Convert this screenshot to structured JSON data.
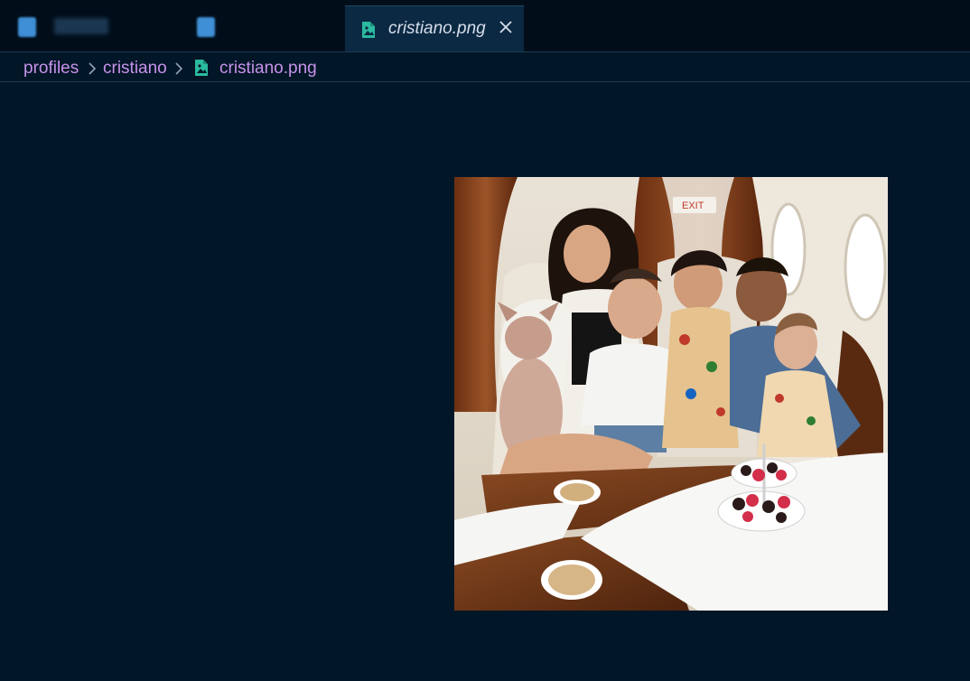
{
  "tabs": {
    "active_label": "cristiano.png"
  },
  "breadcrumb": {
    "items": [
      "profiles",
      "cristiano",
      "cristiano.png"
    ]
  },
  "icons": {
    "file_icon": "image-file-icon",
    "close_icon": "close-icon",
    "separator_icon": "chevron-right-icon"
  },
  "colors": {
    "background": "#011627",
    "tab_bar": "#010e1a",
    "active_tab": "#0b2942",
    "breadcrumb_text": "#c792ea",
    "image_icon": "#2bbaa0"
  }
}
